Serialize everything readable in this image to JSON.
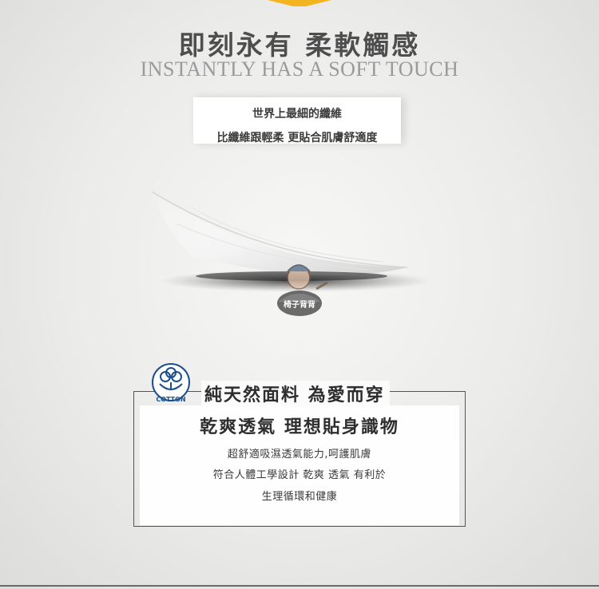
{
  "heading": {
    "title_cn": "即刻永有 柔軟觸感",
    "title_en": "INSTANTLY HAS A SOFT TOUCH"
  },
  "intro": {
    "line1": "世界上最細的纖維",
    "line2": "比纖維跟輕柔 更貼合肌膚舒適度"
  },
  "watermark": {
    "text": "椅子背背"
  },
  "cotton_badge": {
    "label": "COTTON"
  },
  "features": {
    "headline1": "純天然面料 為愛而穿",
    "headline2": "乾爽透氣 理想貼身識物",
    "lines": [
      "超舒適吸濕透氣能力,呵護肌膚",
      "符合人體工學設計 乾爽 透氣 有利於",
      "生理循環和健康"
    ]
  },
  "colors": {
    "accent": "#f2b51f",
    "cotton_blue": "#1c4f8c",
    "heading_gray": "#4e4e4e"
  }
}
